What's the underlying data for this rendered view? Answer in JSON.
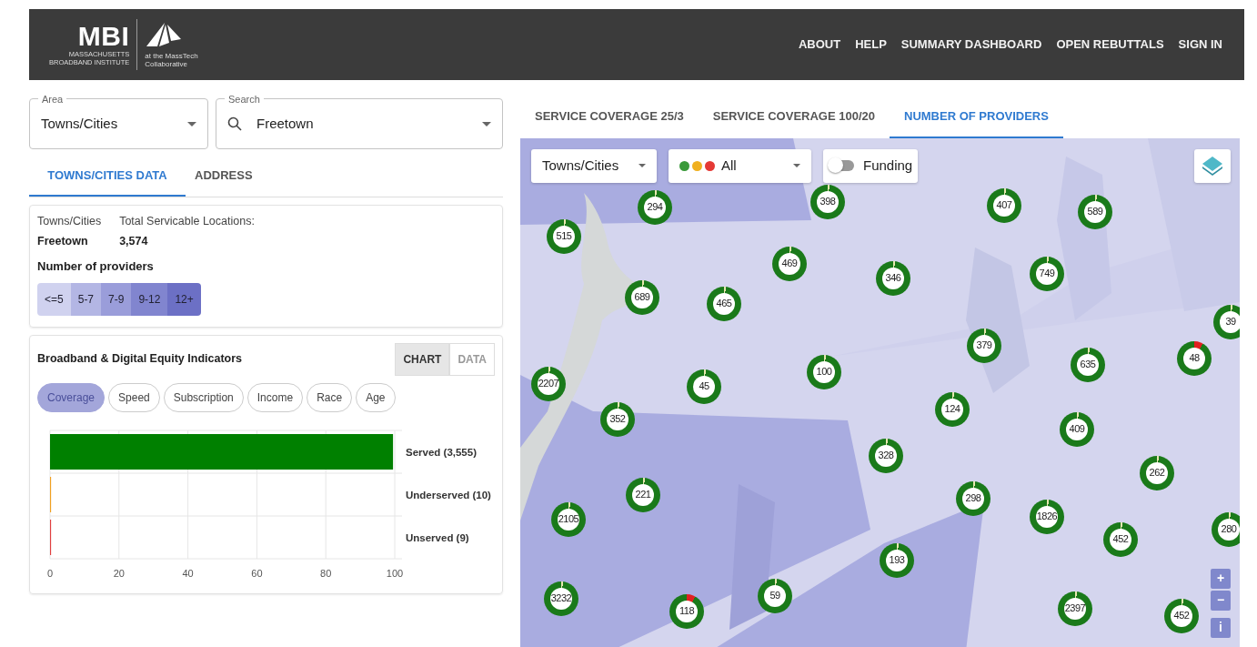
{
  "header": {
    "logo_title": "MBI",
    "logo_subtitle": [
      "MASSACHUSETTS",
      "BROADBAND INSTITUTE"
    ],
    "partner_text": [
      "at the MassTech",
      "Collaborative"
    ],
    "nav": [
      "ABOUT",
      "HELP",
      "SUMMARY DASHBOARD",
      "OPEN REBUTTALS",
      "SIGN IN"
    ]
  },
  "filters": {
    "area": {
      "label": "Area",
      "value": "Towns/Cities"
    },
    "search": {
      "label": "Search",
      "value": "Freetown"
    }
  },
  "panel_tabs": [
    {
      "label": "TOWNS/CITIES DATA",
      "selected": true
    },
    {
      "label": "ADDRESS",
      "selected": false
    }
  ],
  "summary": {
    "type_label": "Towns/Cities",
    "name": "Freetown",
    "total_label": "Total Servicable Locations:",
    "total": "3,574",
    "legend_title": "Number of providers",
    "legend": [
      {
        "label": "<=5",
        "color": "#d0d2ef"
      },
      {
        "label": "5-7",
        "color": "#b3b6e4"
      },
      {
        "label": "7-9",
        "color": "#9a9dda"
      },
      {
        "label": "9-12",
        "color": "#8185cf"
      },
      {
        "label": "12+",
        "color": "#6c70c5"
      }
    ]
  },
  "indicators": {
    "title": "Broadband & Digital Equity Indicators",
    "view_toggle": [
      {
        "label": "CHART",
        "selected": true
      },
      {
        "label": "DATA",
        "selected": false
      }
    ],
    "chips": [
      {
        "label": "Coverage",
        "selected": true
      },
      {
        "label": "Speed",
        "selected": false
      },
      {
        "label": "Subscription",
        "selected": false
      },
      {
        "label": "Income",
        "selected": false
      },
      {
        "label": "Race",
        "selected": false
      },
      {
        "label": "Age",
        "selected": false
      }
    ],
    "chart_data": {
      "type": "bar",
      "orientation": "horizontal",
      "stacked": true,
      "categories": [
        "Served (3,555)",
        "Underserved (10)",
        "Unserved (9)"
      ],
      "series": [
        {
          "color": "#008000",
          "values": [
            99.5,
            null,
            null
          ]
        },
        {
          "color": "#f0a020",
          "values": [
            null,
            0.3,
            null
          ]
        },
        {
          "color": "#e04040",
          "values": [
            null,
            null,
            0.3
          ]
        }
      ],
      "xlim": [
        0,
        100
      ],
      "xticks": [
        0,
        20,
        40,
        60,
        80,
        100
      ],
      "grid": true
    }
  },
  "map": {
    "tabs": [
      {
        "label": "SERVICE COVERAGE 25/3",
        "selected": false
      },
      {
        "label": "SERVICE COVERAGE 100/20",
        "selected": false
      },
      {
        "label": "NUMBER OF PROVIDERS",
        "selected": true
      }
    ],
    "area_select": "Towns/Cities",
    "status_filter": {
      "label": "All",
      "dots": [
        {
          "color": "#3a9a3a"
        },
        {
          "color": "#f0b020"
        },
        {
          "color": "#e53935"
        }
      ]
    },
    "funding": {
      "label": "Funding",
      "on": false
    },
    "markers": [
      {
        "label": "294",
        "warning": false
      },
      {
        "label": "515",
        "warning": false
      },
      {
        "label": "398",
        "warning": false
      },
      {
        "label": "407",
        "warning": false
      },
      {
        "label": "589",
        "warning": false
      },
      {
        "label": "469",
        "warning": false
      },
      {
        "label": "346",
        "warning": false
      },
      {
        "label": "749",
        "warning": false
      },
      {
        "label": "689",
        "warning": false
      },
      {
        "label": "465",
        "warning": false
      },
      {
        "label": "379",
        "warning": false
      },
      {
        "label": "635",
        "warning": false
      },
      {
        "label": "48",
        "warning": true
      },
      {
        "label": "2207",
        "warning": false
      },
      {
        "label": "45",
        "warning": false
      },
      {
        "label": "100",
        "warning": false
      },
      {
        "label": "124",
        "warning": false
      },
      {
        "label": "409",
        "warning": false
      },
      {
        "label": "352",
        "warning": false
      },
      {
        "label": "328",
        "warning": false
      },
      {
        "label": "262",
        "warning": false
      },
      {
        "label": "221",
        "warning": false
      },
      {
        "label": "298",
        "warning": false
      },
      {
        "label": "1826",
        "warning": false
      },
      {
        "label": "2105",
        "warning": false
      },
      {
        "label": "452",
        "warning": false
      },
      {
        "label": "280",
        "warning": false
      },
      {
        "label": "193",
        "warning": false
      },
      {
        "label": "3232",
        "warning": false
      },
      {
        "label": "118",
        "warning": true
      },
      {
        "label": "59",
        "warning": false
      },
      {
        "label": "2397",
        "warning": false
      },
      {
        "label": "452",
        "warning": false
      },
      {
        "label": "39",
        "warning": false
      }
    ],
    "zoom_controls": [
      "+",
      "−",
      "i"
    ]
  }
}
